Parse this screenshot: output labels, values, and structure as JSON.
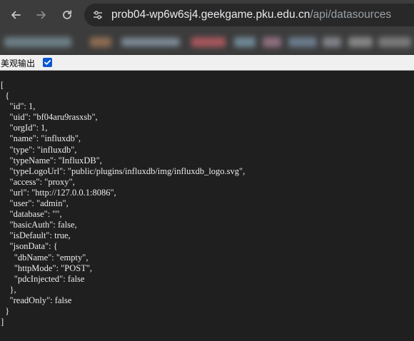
{
  "browser": {
    "url_host": "prob04-wp6w6sj4.geekgame.pku.edu.cn",
    "url_path": "/api/datasources",
    "back_icon": "arrow-left-icon",
    "forward_icon": "arrow-right-icon",
    "reload_icon": "reload-icon",
    "site_info_icon": "tune-icon"
  },
  "bookmarks_bar": {
    "blurred": true
  },
  "pretty_print": {
    "label": "美观输出",
    "checked": true
  },
  "json_lines": [
    "[",
    "  {",
    "    \"id\": 1,",
    "    \"uid\": \"bf04aru9rasxsb\",",
    "    \"orgId\": 1,",
    "    \"name\": \"influxdb\",",
    "    \"type\": \"influxdb\",",
    "    \"typeName\": \"InfluxDB\",",
    "    \"typeLogoUrl\": \"public/plugins/influxdb/img/influxdb_logo.svg\",",
    "    \"access\": \"proxy\",",
    "    \"url\": \"http://127.0.0.1:8086\",",
    "    \"user\": \"admin\",",
    "    \"database\": \"\",",
    "    \"basicAuth\": false,",
    "    \"isDefault\": true,",
    "    \"jsonData\": {",
    "      \"dbName\": \"empty\",",
    "      \"httpMode\": \"POST\",",
    "      \"pdcInjected\": false",
    "    },",
    "    \"readOnly\": false",
    "  }",
    "]"
  ],
  "colors": {
    "toolbar_bg": "#3c3c3c",
    "omnibox_bg": "#282828",
    "page_bg": "#1f1f1f",
    "text": "#ececec",
    "checkbox_accent": "#0b57d0"
  }
}
